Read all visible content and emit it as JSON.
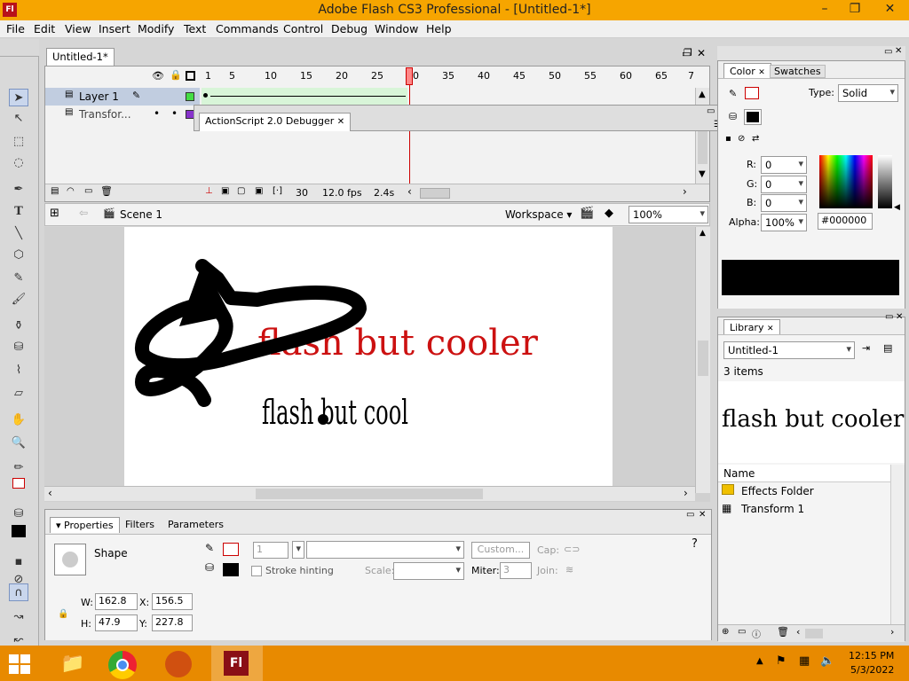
{
  "window": {
    "title": "Adobe Flash CS3 Professional - [Untitled-1*]",
    "app_icon": "Fl",
    "minimize": "–",
    "restore": "❐",
    "close": "✕"
  },
  "menu": [
    "File",
    "Edit",
    "View",
    "Insert",
    "Modify",
    "Text",
    "Commands",
    "Control",
    "Debug",
    "Window",
    "Help"
  ],
  "document_tab": "Untitled-1*",
  "timeline": {
    "frame_numbers": [
      "1",
      "5",
      "10",
      "15",
      "20",
      "25",
      "30",
      "35",
      "40",
      "45",
      "50",
      "55",
      "60",
      "65",
      "7"
    ],
    "layers": [
      {
        "name": "Layer 1",
        "color": "#44dd44"
      },
      {
        "name": "Transfor...",
        "color": "#8833cc"
      }
    ],
    "current_frame": "30",
    "fps": "12.0 fps",
    "elapsed": "2.4s"
  },
  "debugger_panel": {
    "title": "ActionScript 2.0 Debugger"
  },
  "editbar": {
    "scene": "Scene 1",
    "workspace": "Workspace",
    "zoom": "100%"
  },
  "stage": {
    "red_text": "flash but cooler",
    "red_text_color": "#cc1111",
    "black_text": "flash but cool"
  },
  "properties": {
    "tabs": [
      "Properties",
      "Filters",
      "Parameters"
    ],
    "type": "Shape",
    "stroke_size": "1",
    "custom_button": "Custom...",
    "cap_label": "Cap:",
    "stroke_hinting": "Stroke hinting",
    "scale_label": "Scale:",
    "miter_label": "Miter:",
    "miter_value": "3",
    "join_label": "Join:",
    "w_label": "W:",
    "w": "162.8",
    "x_label": "X:",
    "x": "156.5",
    "h_label": "H:",
    "h": "47.9",
    "y_label": "Y:",
    "y": "227.8"
  },
  "color_panel": {
    "tabs": [
      "Color",
      "Swatches"
    ],
    "type_label": "Type:",
    "type": "Solid",
    "r_label": "R:",
    "r": "0",
    "g_label": "G:",
    "g": "0",
    "b_label": "B:",
    "b": "0",
    "alpha_label": "Alpha:",
    "alpha": "100%",
    "hex": "#000000",
    "preview_color": "#000000"
  },
  "library": {
    "tab": "Library",
    "document": "Untitled-1",
    "count": "3 items",
    "preview_text": "flash but cooler",
    "name_header": "Name",
    "items": [
      {
        "name": "Effects Folder",
        "icon": "folder-icon"
      },
      {
        "name": "Transform 1",
        "icon": "movieclip-icon"
      }
    ]
  },
  "taskbar": {
    "time": "12:15 PM",
    "date": "5/3/2022",
    "flash_icon": "Fl"
  }
}
